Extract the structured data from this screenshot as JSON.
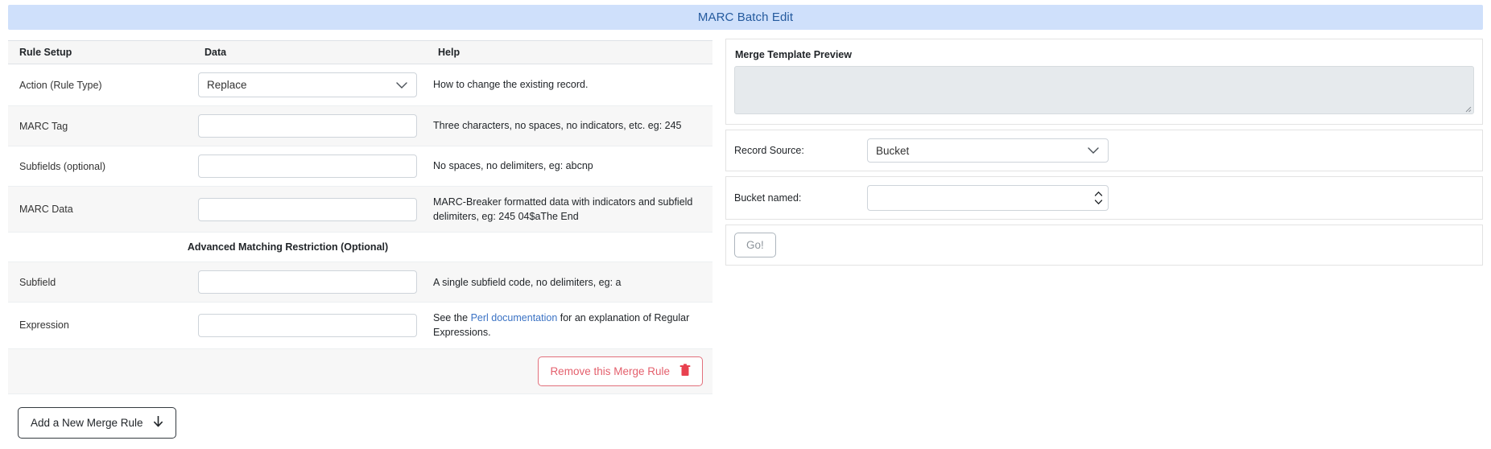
{
  "header": {
    "title": "MARC Batch Edit"
  },
  "rules_table": {
    "columns": [
      "Rule Setup",
      "Data",
      "Help"
    ],
    "rows": [
      {
        "label": "Action (Rule Type)",
        "value": "Replace",
        "help": "How to change the existing record."
      },
      {
        "label": "MARC Tag",
        "value": "",
        "help": "Three characters, no spaces, no indicators, etc. eg: 245"
      },
      {
        "label": "Subfields (optional)",
        "value": "",
        "help": "No spaces, no delimiters, eg: abcnp"
      },
      {
        "label": "MARC Data",
        "value": "",
        "help": "MARC-Breaker formatted data with indicators and subfield delimiters, eg: 245 04$aThe End"
      }
    ],
    "section_title": "Advanced Matching Restriction (Optional)",
    "advanced_rows": [
      {
        "label": "Subfield",
        "value": "",
        "help": "A single subfield code, no delimiters, eg: a"
      },
      {
        "label": "Expression",
        "value": "",
        "help_before": "See the ",
        "help_link": "Perl documentation",
        "help_after": " for an explanation of Regular Expressions."
      }
    ]
  },
  "buttons": {
    "remove_rule": "Remove this Merge Rule",
    "remove_rule_icon": "trash-icon",
    "add_rule": "Add a New Merge Rule",
    "add_rule_icon": "arrow-down-icon",
    "go": "Go!"
  },
  "right_panel": {
    "preview_label": "Merge Template Preview",
    "preview_value": "",
    "record_source_label": "Record Source:",
    "record_source_value": "Bucket",
    "bucket_label": "Bucket named:",
    "bucket_value": "",
    "dropdown_icon": "chevron-down-icon",
    "spinner_icon": "spinner-arrows-icon"
  },
  "colors": {
    "header_bg": "#cfe0fb",
    "header_text": "#245a9e",
    "danger": "#e4606d",
    "link": "#3a72c4",
    "stripe": "#f7f7f7"
  }
}
